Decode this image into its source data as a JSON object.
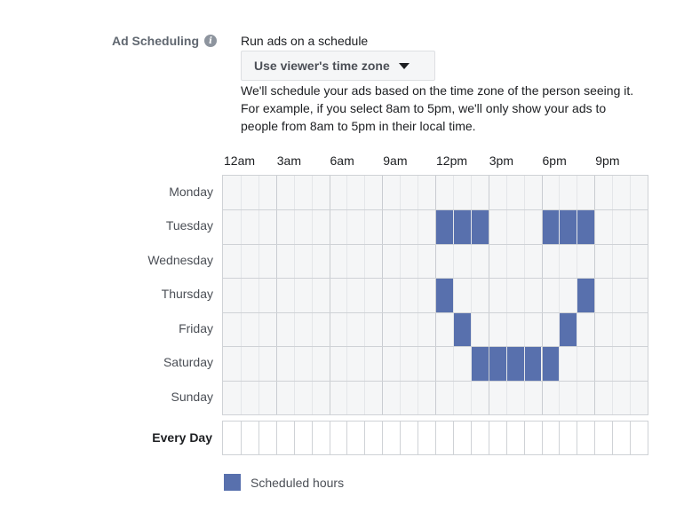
{
  "section_label": "Ad Scheduling",
  "run_label": "Run ads on a schedule",
  "timezone_dropdown": {
    "selected": "Use viewer's time zone"
  },
  "description_lines": [
    "We'll schedule your ads based on the time zone of the person seeing it.",
    "For example, if you select 8am to 5pm, we'll only show your ads to",
    "people from 8am to 5pm in their local time."
  ],
  "hour_labels": [
    "12am",
    "3am",
    "6am",
    "9am",
    "12pm",
    "3pm",
    "6pm",
    "9pm"
  ],
  "days": [
    "Monday",
    "Tuesday",
    "Wednesday",
    "Thursday",
    "Friday",
    "Saturday",
    "Sunday"
  ],
  "every_day_label": "Every Day",
  "legend_label": "Scheduled hours",
  "colors": {
    "scheduled": "#5870ad",
    "grid_bg": "#f5f6f7",
    "grid_line": "#cfd2d6"
  },
  "hours_per_day": 24,
  "scheduled": {
    "Monday": [],
    "Tuesday": [
      12,
      13,
      14,
      18,
      19,
      20
    ],
    "Wednesday": [],
    "Thursday": [
      12,
      20
    ],
    "Friday": [
      13,
      19
    ],
    "Saturday": [
      14,
      15,
      16,
      17,
      18
    ],
    "Sunday": []
  }
}
